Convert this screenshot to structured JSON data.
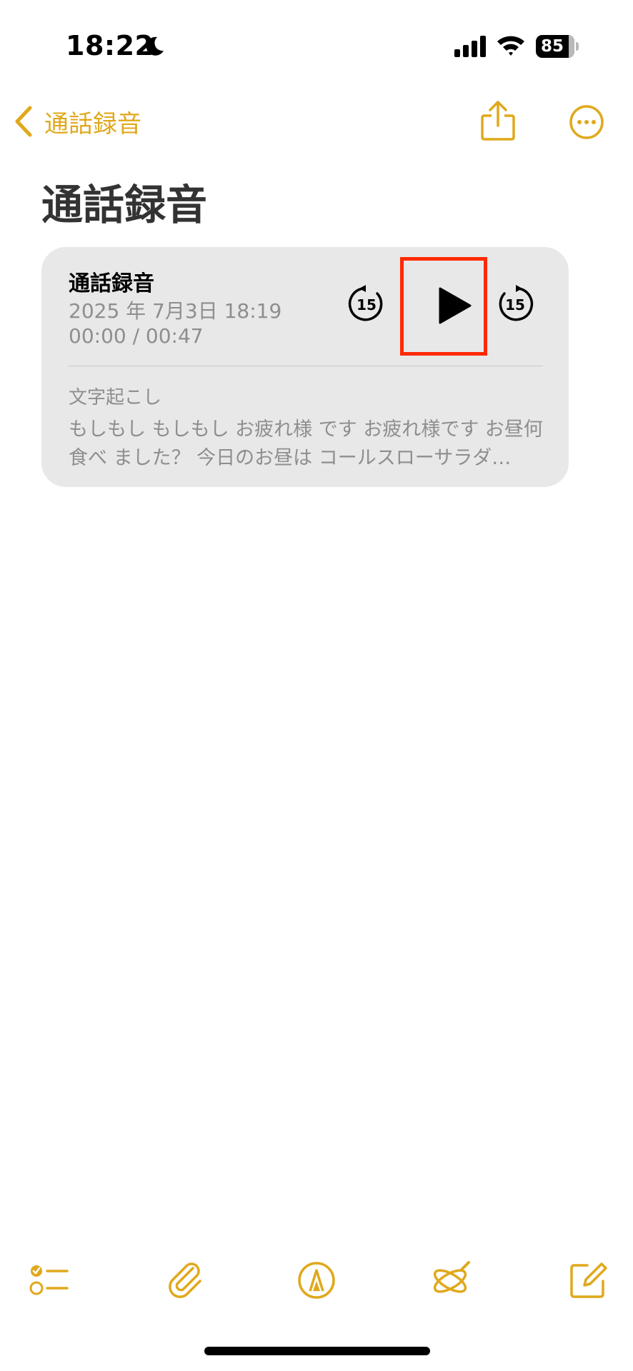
{
  "status_bar": {
    "time": "18:22",
    "battery": "85"
  },
  "nav": {
    "back_label": "通話録音"
  },
  "page": {
    "title": "通話録音"
  },
  "audio": {
    "title": "通話録音",
    "date": "2025 年 7月3日 18:19",
    "playback": "00:00 / 00:47",
    "skip_back_seconds": "15",
    "skip_forward_seconds": "15",
    "transcript_label": "文字起こし",
    "transcript_preview": "もしもし もしもし お疲れ様 です お疲れ様です お昼何食べ ました？ 今日のお昼は コールスローサラダ…"
  },
  "colors": {
    "accent": "#e0a81b",
    "highlight": "#ff2a00",
    "card_bg": "#e8e8e8",
    "secondary_text": "#8e8e8e"
  }
}
